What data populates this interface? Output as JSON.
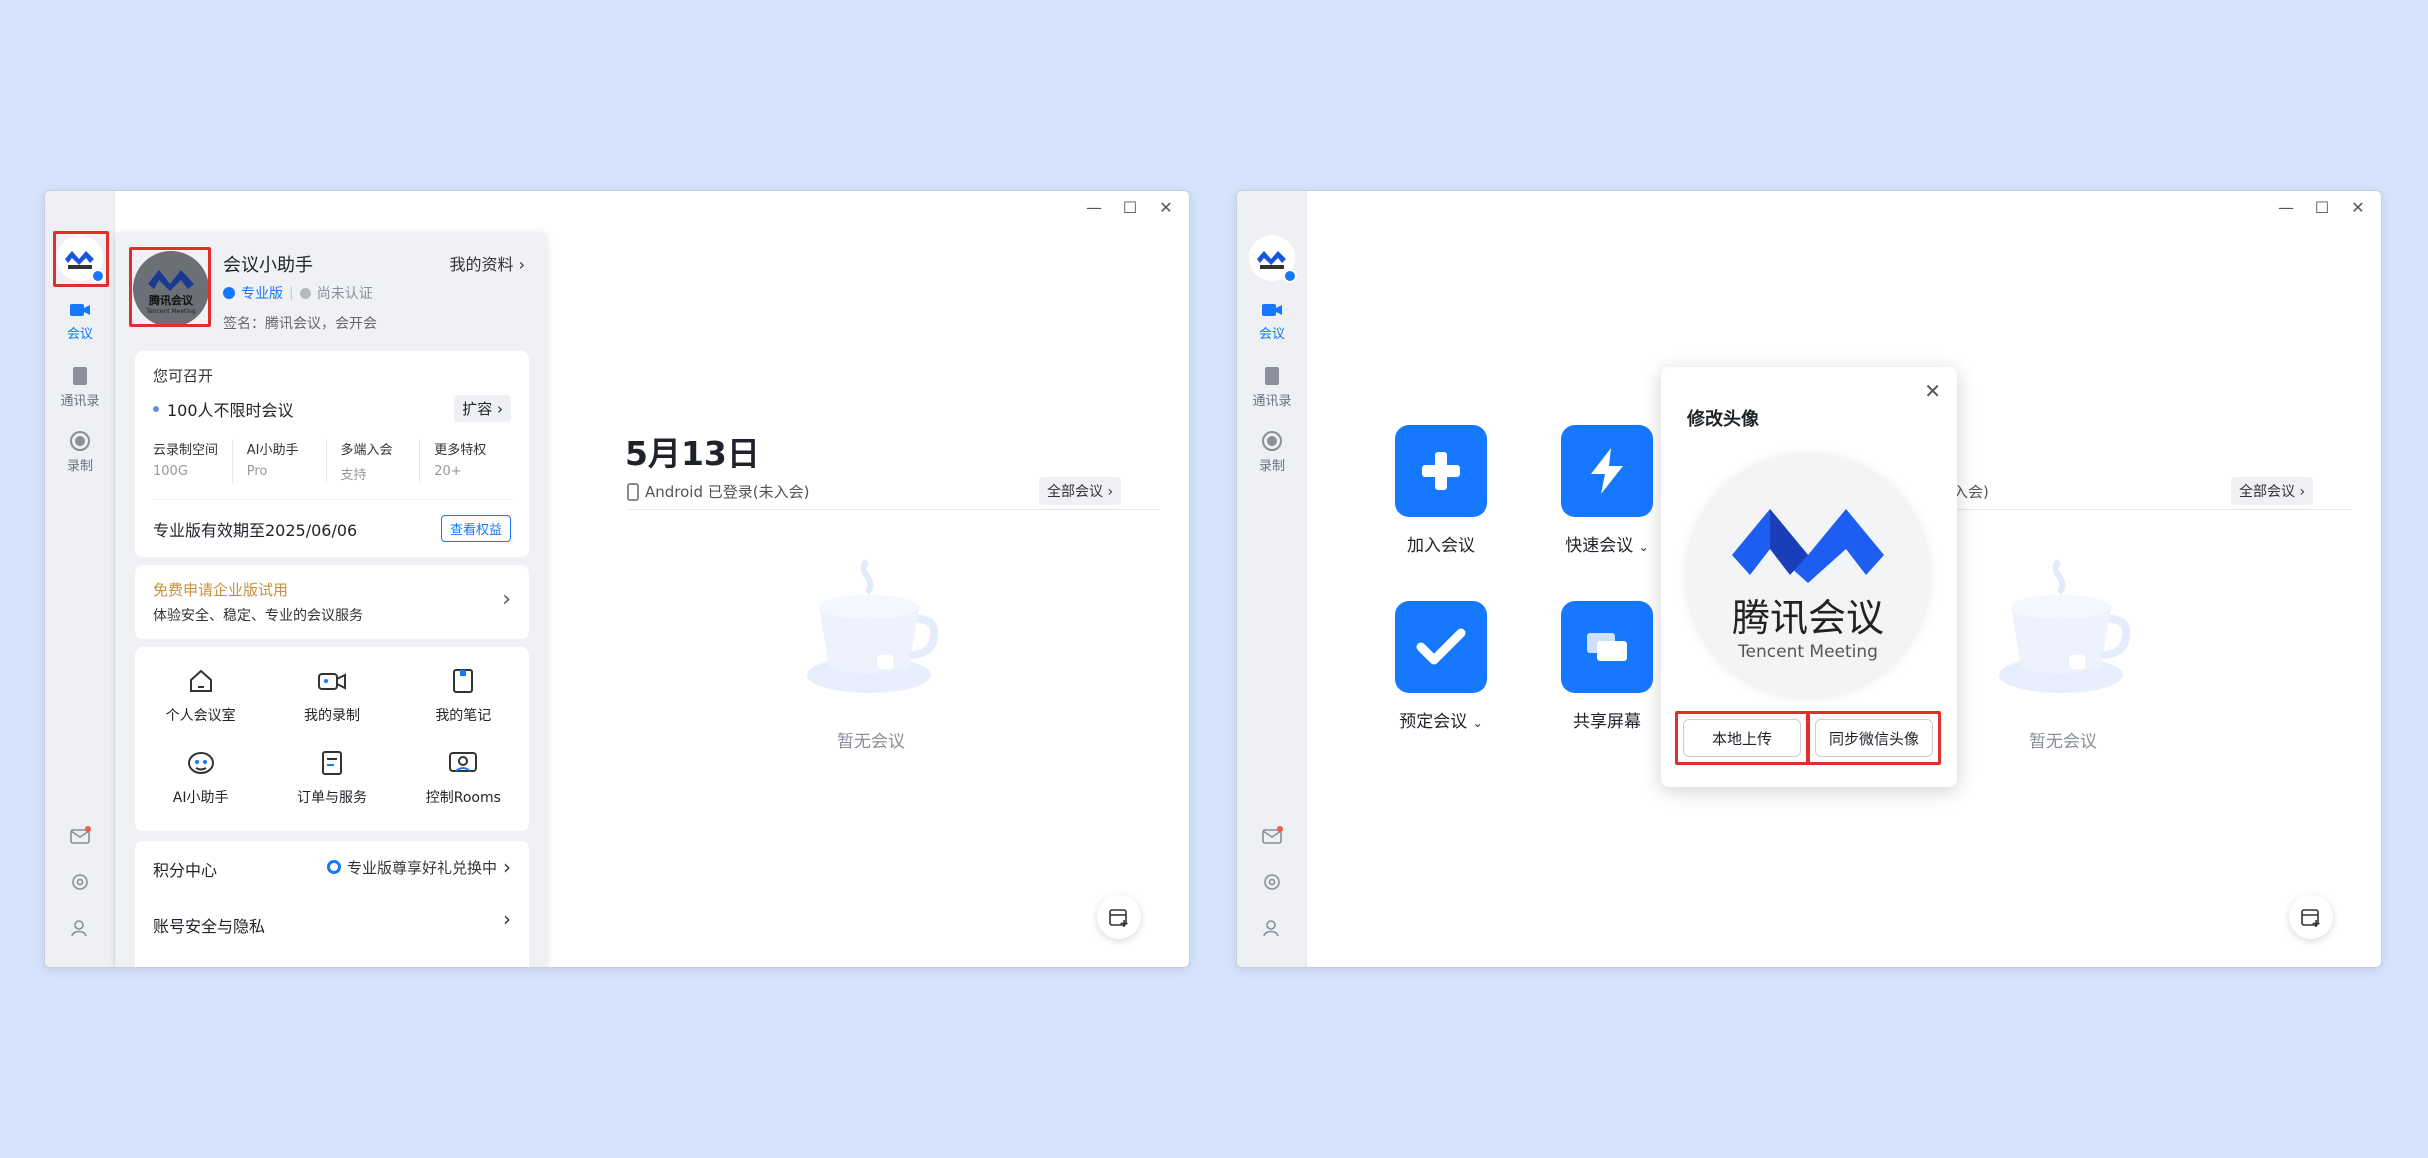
{
  "left_window": {
    "controls": {
      "minimize": "—",
      "maximize": "☐",
      "close": "✕"
    },
    "rail": {
      "logo_text": "腾讯会议",
      "nav": [
        {
          "label": "会议",
          "active": true
        },
        {
          "label": "通讯录",
          "active": false
        },
        {
          "label": "录制",
          "active": false
        }
      ]
    },
    "profile": {
      "name": "会议小助手",
      "my_profile_link": "我的资料",
      "edition_badge": "专业版",
      "verification": "尚未认证",
      "signature": "签名：腾讯会议，会开会",
      "avatar_text": "腾讯会议",
      "avatar_subtext": "Tencent Meeting",
      "capability": {
        "heading": "您可召开",
        "item": "100人不限时会议",
        "expand_label": "扩容",
        "features": [
          {
            "title": "云录制空间",
            "value": "100G"
          },
          {
            "title": "AI小助手",
            "value": "Pro"
          },
          {
            "title": "多端入会",
            "value": "支持"
          },
          {
            "title": "更多特权",
            "value": "20+"
          }
        ],
        "validity": "专业版有效期至2025/06/06",
        "view_rights_label": "查看权益"
      },
      "enterprise_trial": {
        "title": "免费申请企业版试用",
        "subtitle": "体验安全、稳定、专业的会议服务"
      },
      "tools": [
        {
          "label": "个人会议室",
          "icon": "home-icon"
        },
        {
          "label": "我的录制",
          "icon": "video-camera-icon"
        },
        {
          "label": "我的笔记",
          "icon": "note-icon"
        },
        {
          "label": "AI小助手",
          "icon": "ai-assistant-icon"
        },
        {
          "label": "订单与服务",
          "icon": "order-icon"
        },
        {
          "label": "控制Rooms",
          "icon": "rooms-icon"
        }
      ],
      "points_center": {
        "label": "积分中心",
        "promo": "专业版尊享好礼兑换中"
      },
      "account_security": "账号安全与隐私"
    },
    "main": {
      "date": "5月13日",
      "device_status": "Android 已登录(未入会)",
      "all_meetings": "全部会议",
      "empty_text": "暂无会议"
    }
  },
  "right_window": {
    "controls": {
      "minimize": "—",
      "maximize": "☐",
      "close": "✕"
    },
    "rail": {
      "logo_text": "腾讯会议",
      "nav": [
        {
          "label": "会议",
          "active": true
        },
        {
          "label": "通讯录",
          "active": false
        },
        {
          "label": "录制",
          "active": false
        }
      ]
    },
    "actions": [
      {
        "label": "加入会议",
        "icon": "plus-icon"
      },
      {
        "label": "快速会议",
        "icon": "lightning-icon",
        "dropdown": true
      },
      {
        "label": "预定会议",
        "icon": "check-icon",
        "dropdown": true
      },
      {
        "label": "共享屏幕",
        "icon": "screen-share-icon"
      }
    ],
    "main": {
      "device_status_partial": "入会)",
      "all_meetings": "全部会议",
      "empty_text": "暂无会议"
    },
    "avatar_dialog": {
      "title": "修改头像",
      "logo_text": "腾讯会议",
      "logo_subtext": "Tencent Meeting",
      "upload_local": "本地上传",
      "sync_wechat": "同步微信头像"
    }
  },
  "colors": {
    "background": "#d6e3fb",
    "brand_blue": "#1677ff",
    "highlight_red": "#e0302b",
    "gold_text": "#c8903e"
  }
}
